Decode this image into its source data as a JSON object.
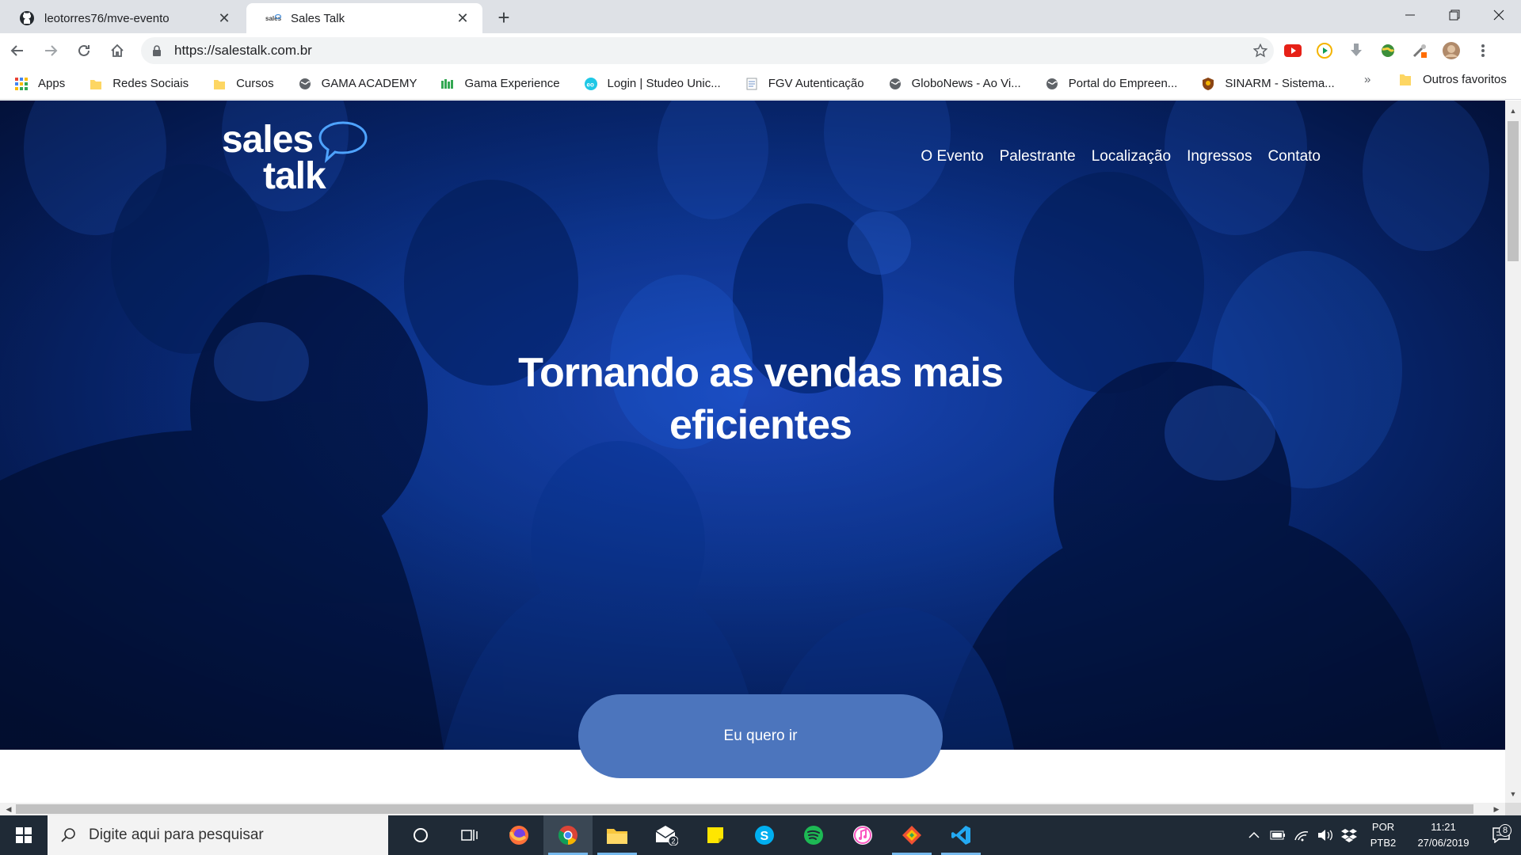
{
  "browser": {
    "tabs": [
      {
        "title": "leotorres76/mve-evento",
        "icon": "github-icon",
        "active": false
      },
      {
        "title": "Sales Talk",
        "icon": "sales-talk-favicon",
        "active": true
      }
    ],
    "url": "https://salestalk.com.br",
    "bookmarks": [
      {
        "label": "Apps",
        "icon": "apps-grid-icon"
      },
      {
        "label": "Redes Sociais",
        "icon": "folder-icon"
      },
      {
        "label": "Cursos",
        "icon": "folder-icon"
      },
      {
        "label": "GAMA ACADEMY",
        "icon": "globe-icon"
      },
      {
        "label": "Gama Experience",
        "icon": "bars-icon"
      },
      {
        "label": "Login | Studeo Unic...",
        "icon": "studeo-icon"
      },
      {
        "label": "FGV Autenticação",
        "icon": "page-icon"
      },
      {
        "label": "GloboNews - Ao Vi...",
        "icon": "globe-icon"
      },
      {
        "label": "Portal do Empreen...",
        "icon": "globe-icon"
      },
      {
        "label": "SINARM - Sistema...",
        "icon": "badge-icon"
      }
    ],
    "bookmarks_more": "»",
    "other_bookmarks": "Outros favoritos"
  },
  "page": {
    "logo_line1": "sales",
    "logo_line2": "talk",
    "nav": [
      "O Evento",
      "Palestrante",
      "Localização",
      "Ingressos",
      "Contato"
    ],
    "headline_line1": "Tornando as vendas mais",
    "headline_line2": "eficientes",
    "cta_label": "Eu quero ir"
  },
  "taskbar": {
    "search_placeholder": "Digite aqui para pesquisar",
    "mail_badge": "2",
    "language_line1": "POR",
    "language_line2": "PTB2",
    "time": "11:21",
    "date": "27/06/2019",
    "notifications": "8"
  },
  "colors": {
    "hero_blue": "#0f3ea8",
    "cta_blue": "#4c75bd",
    "taskbar": "#1f2a36"
  }
}
